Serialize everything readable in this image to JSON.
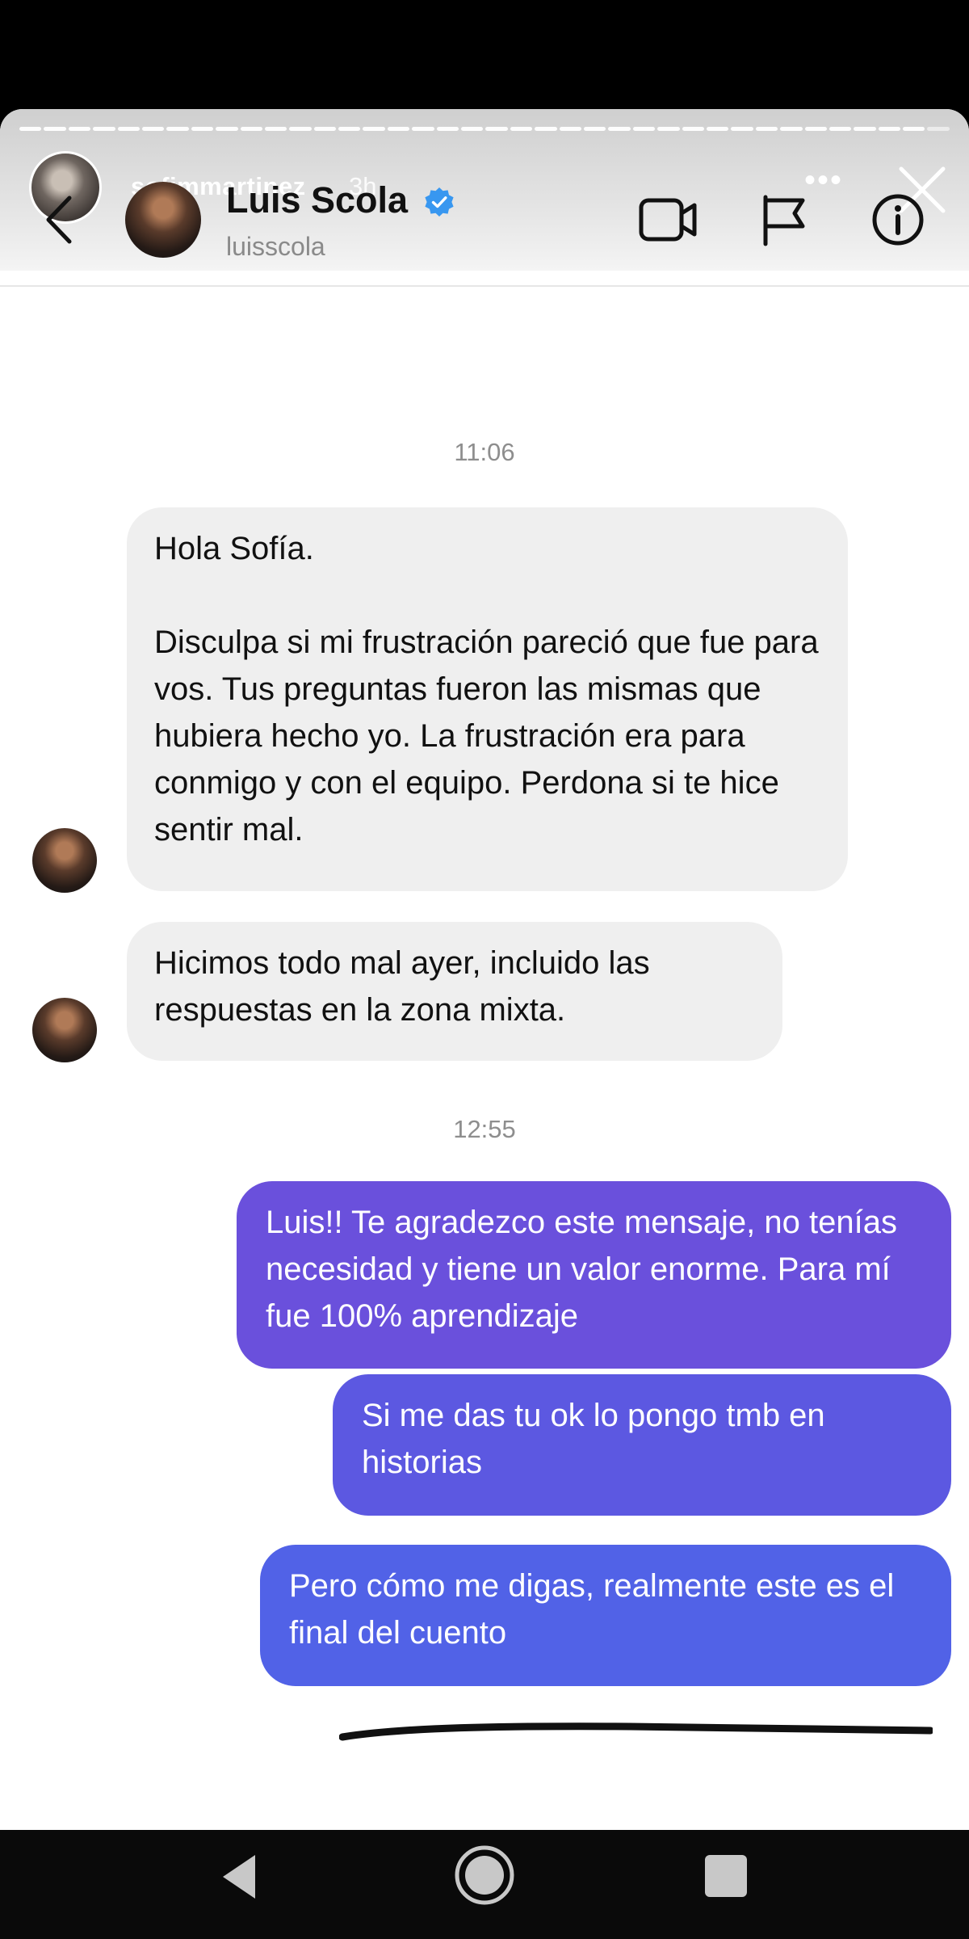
{
  "story": {
    "username": "sofimmartinez",
    "time_ago": "3h",
    "more_label": "•••"
  },
  "dm": {
    "contact_name": "Luis Scola",
    "contact_handle": "luisscola"
  },
  "messages": {
    "time1": "11:06",
    "m1": "Hola Sofía.\n\nDisculpa si mi frustración pareció que fue para vos. Tus preguntas fueron las mismas que hubiera hecho yo. La frustración era para conmigo y con el equipo. Perdona si te hice sentir mal.",
    "m2": "Hicimos todo mal ayer, incluido las respuestas en la zona mixta.",
    "time2": "12:55",
    "m3": "Luis!! Te agradezco este mensaje, no tenías necesidad y tiene un valor enorme. Para mí fue 100% aprendizaje",
    "m4": "Si me das tu ok lo pongo tmb en historias",
    "m5": "Pero cómo me digas, realmente este es el final del cuento"
  },
  "colors": {
    "incoming_bubble": "#efefef",
    "outgoing_top": "#6b4fdc",
    "outgoing_bottom": "#4f5ee8",
    "verified": "#3897f0"
  },
  "icons": [
    "chevron-left-icon",
    "verified-badge-icon",
    "video-call-icon",
    "flag-icon",
    "info-icon",
    "close-icon",
    "nav-back-icon",
    "nav-home-icon",
    "nav-recents-icon"
  ]
}
